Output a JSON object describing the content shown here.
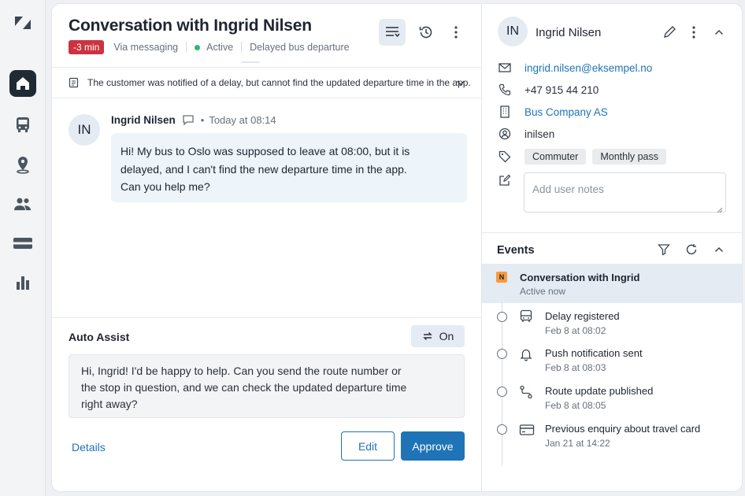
{
  "nav": {
    "items": [
      "zendesk-logo",
      "home",
      "bus",
      "location",
      "users",
      "ticket",
      "reports"
    ]
  },
  "conversation": {
    "title": "Conversation with Ingrid Nilsen",
    "sla_badge": "-3 min",
    "channel": "Via messaging",
    "status": "Active",
    "subject": "Delayed bus departure",
    "summary": "The customer was notified of a delay, but cannot find the updated departure time in the app.",
    "message": {
      "initials": "IN",
      "sender": "Ingrid Nilsen",
      "separator": "•",
      "time": "Today at 08:14",
      "lines": [
        "Hi! My bus to Oslo was supposed to leave at 08:00, but it is",
        "delayed, and I can't find the new departure time in the app.",
        "Can you help me?"
      ]
    }
  },
  "auto_assist": {
    "title": "Auto Assist",
    "toggle_label": "On",
    "suggestion_lines": [
      "Hi, Ingrid! I'd be happy to help. Can you send the route number or",
      "the stop in question, and we can check the updated departure time",
      "right away?"
    ],
    "details_link": "Details",
    "edit_button": "Edit",
    "approve_button": "Approve"
  },
  "customer": {
    "initials": "IN",
    "name": "Ingrid Nilsen",
    "email": "ingrid.nilsen@eksempel.no",
    "phone": "+47 915 44 210",
    "organization": "Bus Company AS",
    "username": "inilsen",
    "tags": [
      "Commuter",
      "Monthly pass"
    ],
    "notes_placeholder": "Add user notes"
  },
  "events": {
    "title": "Events",
    "items": [
      {
        "title": "Conversation with Ingrid",
        "subtitle": "Active now",
        "badge": "N"
      },
      {
        "title": "Delay registered",
        "subtitle": "Feb 8 at 08:02",
        "icon": "bus-icon"
      },
      {
        "title": "Push notification sent",
        "subtitle": "Feb 8 at 08:03",
        "icon": "bell-icon"
      },
      {
        "title": "Route update published",
        "subtitle": "Feb 8 at 08:05",
        "icon": "route-icon"
      },
      {
        "title": "Previous enquiry about travel card",
        "subtitle": "Jan 21 at 14:22",
        "icon": "card-icon"
      }
    ]
  },
  "colors": {
    "accent": "#1f73b7",
    "sla_red": "#cc3340",
    "active_green": "#2eb86b",
    "nav_active": "#1f2a33",
    "badge_orange": "#f79a3e"
  }
}
